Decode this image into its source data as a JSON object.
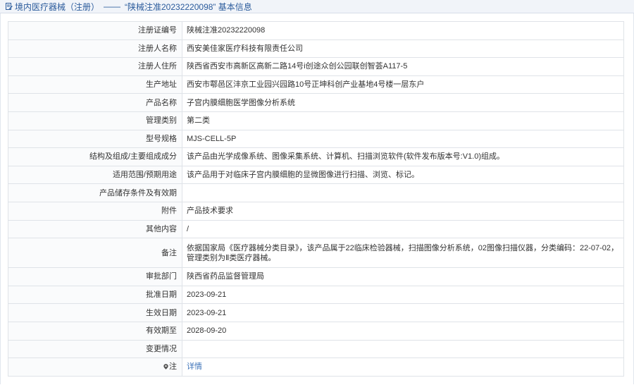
{
  "header": {
    "category": "境内医疗器械（注册）",
    "separator": "——",
    "title": "“陕械注准20232220098” 基本信息"
  },
  "rows": [
    {
      "label": "注册证编号",
      "value": "陕械注准20232220098"
    },
    {
      "label": "注册人名称",
      "value": "西安美佳家医疗科技有限责任公司"
    },
    {
      "label": "注册人住所",
      "value": "陕西省西安市高新区高新二路14号i创途众创公园联创智荟A117-5"
    },
    {
      "label": "生产地址",
      "value": "西安市鄠邑区沣京工业园兴园路10号正坤科创产业基地4号楼一层东户"
    },
    {
      "label": "产品名称",
      "value": "子宫内膜细胞医学图像分析系统"
    },
    {
      "label": "管理类别",
      "value": "第二类"
    },
    {
      "label": "型号规格",
      "value": "MJS-CELL-5P"
    },
    {
      "label": "结构及组成/主要组成成分",
      "value": "该产品由光学成像系统、图像采集系统、计算机、扫描浏览软件(软件发布版本号:V1.0)组成。"
    },
    {
      "label": "适用范围/预期用途",
      "value": "该产品用于对临床子宫内膜细胞的显微图像进行扫描、浏览、标记。"
    },
    {
      "label": "产品储存条件及有效期",
      "value": ""
    },
    {
      "label": "附件",
      "value": "产品技术要求"
    },
    {
      "label": "其他内容",
      "value": "/"
    },
    {
      "label": "备注",
      "value": "依据国家局《医疗器械分类目录》，该产品属于22临床检验器械，扫描图像分析系统，02图像扫描仪器，分类编码：22-07-02，管理类别为Ⅱ类医疗器械。"
    },
    {
      "label": "审批部门",
      "value": "陕西省药品监督管理局"
    },
    {
      "label": "批准日期",
      "value": "2023-09-21"
    },
    {
      "label": "生效日期",
      "value": "2023-09-21"
    },
    {
      "label": "有效期至",
      "value": "2028-09-20"
    },
    {
      "label": "变更情况",
      "value": ""
    },
    {
      "label": "注",
      "value": "详情"
    }
  ],
  "colors": {
    "link": "#3d73b8",
    "header_text": "#2b5b9c"
  },
  "icons": {
    "header": "document-edit-icon",
    "note": "map-pin-icon"
  }
}
